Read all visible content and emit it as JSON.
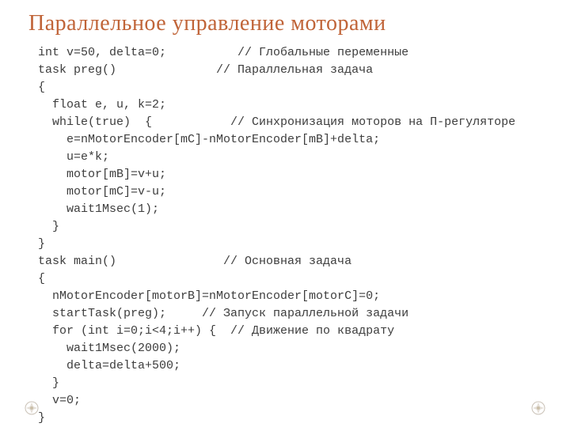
{
  "title": "Параллельное управление моторами",
  "code_lines": [
    "int v=50, delta=0;          // Глобальные переменные",
    "task preg()              // Параллельная задача",
    "{",
    "  float e, u, k=2;",
    "  while(true)  {           // Синхронизация моторов на П-регуляторе",
    "    e=nMotorEncoder[mC]-nMotorEncoder[mB]+delta;",
    "    u=e*k;",
    "    motor[mB]=v+u;",
    "    motor[mC]=v-u;",
    "    wait1Msec(1);",
    "  }",
    "}",
    "task main()               // Основная задача",
    "{",
    "  nMotorEncoder[motorB]=nMotorEncoder[motorC]=0;",
    "  startTask(preg);     // Запуск параллельной задачи",
    "  for (int i=0;i<4;i++) {  // Движение по квадрату",
    "    wait1Msec(2000);",
    "    delta=delta+500;",
    "  }",
    "  v=0;",
    "}"
  ]
}
